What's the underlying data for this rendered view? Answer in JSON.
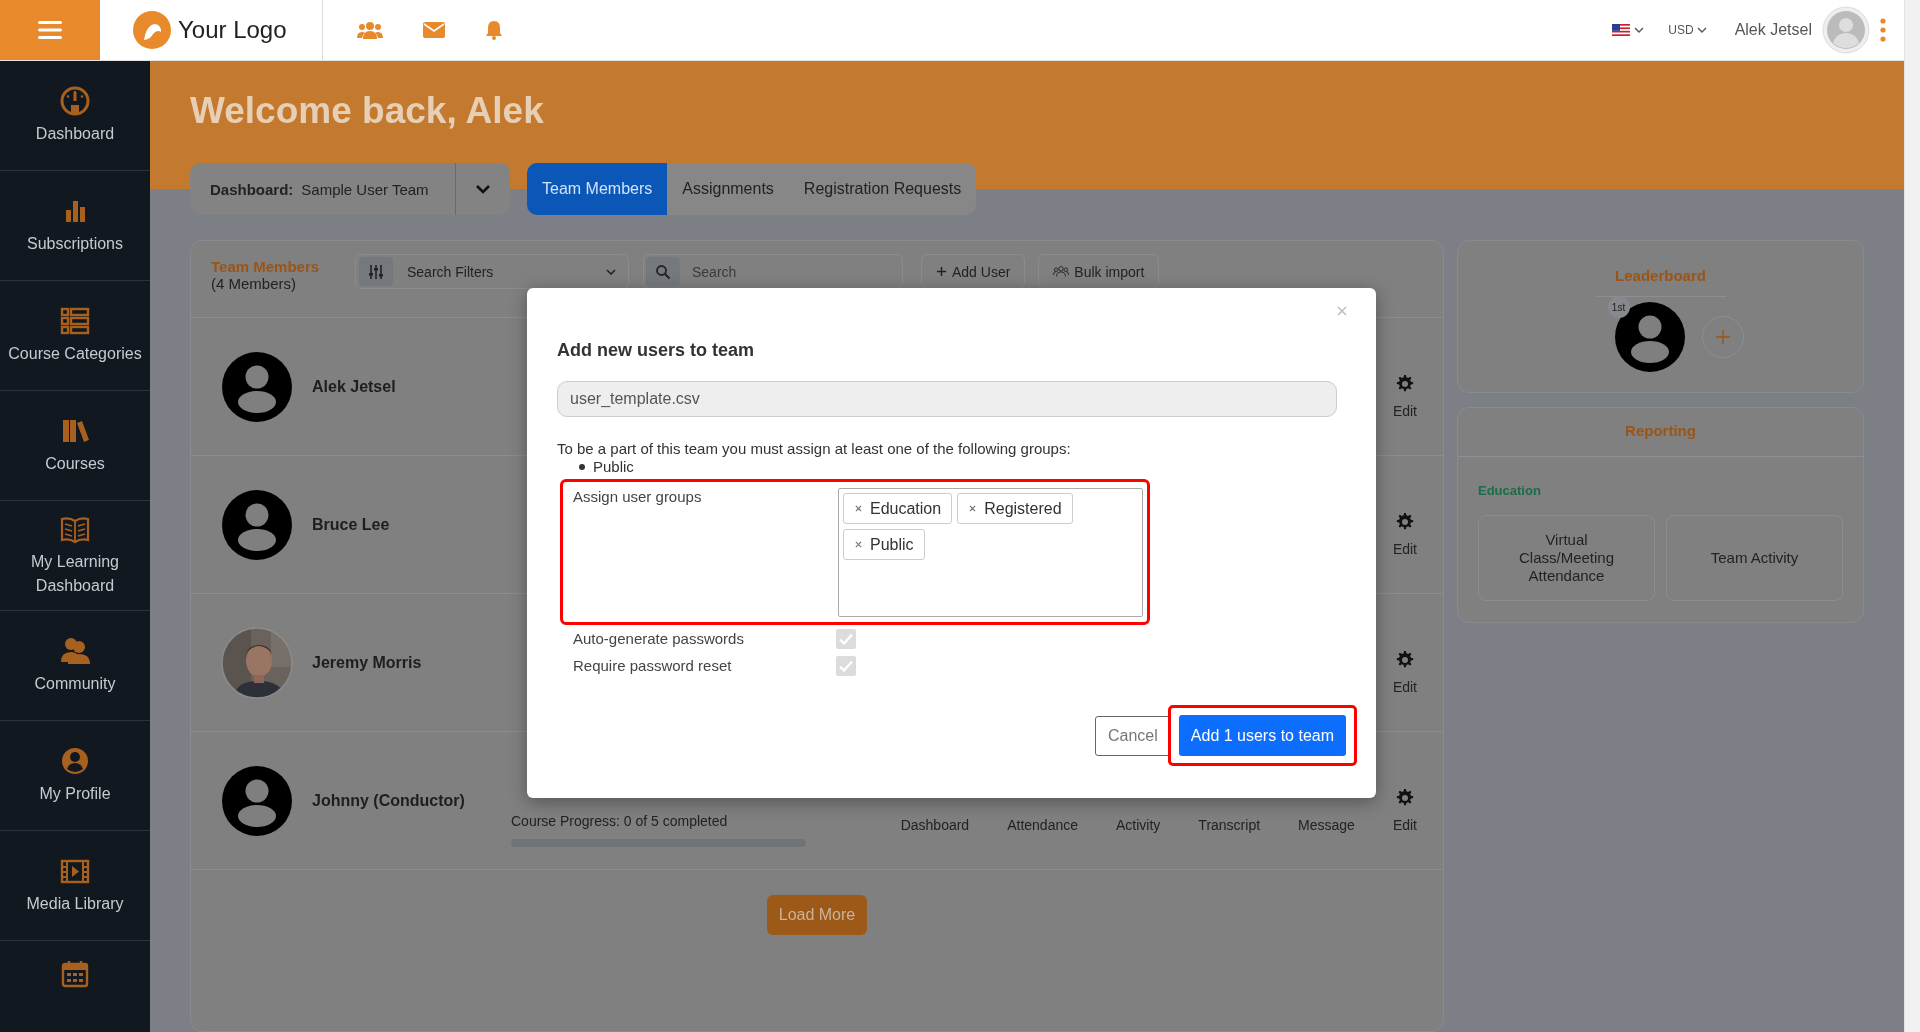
{
  "topbar": {
    "logo": "Your Logo",
    "currency": "USD",
    "user_name": "Alek Jetsel"
  },
  "sidebar": {
    "items": [
      {
        "kind": "labeled",
        "label": "Dashboard"
      },
      {
        "kind": "labeled",
        "label": "Subscriptions"
      },
      {
        "kind": "labeled",
        "label": "Course Categories"
      },
      {
        "kind": "labeled",
        "label": "Courses"
      },
      {
        "kind": "labeled",
        "label": "My Learning Dashboard"
      },
      {
        "kind": "labeled",
        "label": "Community"
      },
      {
        "kind": "labeled",
        "label": "My Profile"
      },
      {
        "kind": "labeled",
        "label": "Media Library"
      },
      {
        "kind": "icon_only"
      }
    ]
  },
  "welcome": "Welcome back, Alek",
  "dashboard_selector": {
    "label": "Dashboard:",
    "value": "Sample User Team"
  },
  "tabs": [
    {
      "label": "Team Members",
      "selected": true
    },
    {
      "label": "Assignments",
      "selected": false
    },
    {
      "label": "Registration Requests",
      "selected": false
    }
  ],
  "team_panel": {
    "title": "Team Members",
    "count": "(4 Members)",
    "filter": "Search Filters",
    "search_placeholder": "Search",
    "add_user": "Add User",
    "bulk_import": "Bulk import"
  },
  "members": [
    {
      "name": "Alek Jetsel",
      "photo": false,
      "actions": [
        "Edit"
      ]
    },
    {
      "name": "Bruce Lee",
      "photo": false,
      "actions": [
        "Edit"
      ]
    },
    {
      "name": "Jeremy Morris",
      "photo": true,
      "actions": [
        "Edit"
      ]
    },
    {
      "name": "Johnny (Conductor)",
      "photo": false,
      "progress": "Course Progress: 0 of 5 completed",
      "level": 0,
      "actions": [
        "Dashboard",
        "Attendance",
        "Activity",
        "Transcript",
        "Message",
        "Edit"
      ]
    }
  ],
  "load_more": "Load More",
  "leaderboard": {
    "title": "Leaderboard",
    "entries": [
      {
        "rank": "1st"
      }
    ]
  },
  "reporting": {
    "title": "Reporting",
    "group": "Education",
    "reports": [
      "Virtual Class/Meeting Attendance",
      "Team Activity"
    ]
  },
  "modal": {
    "title": "Add new users to team",
    "file": "user_template.csv",
    "note": "To be a part of this team you must assign at least one of the following groups:",
    "required_groups": [
      "Public"
    ],
    "groups_label": "Assign user groups",
    "groups_highlighted": true,
    "groups": [
      "Education",
      "Registered",
      "Public"
    ],
    "options": [
      {
        "label": "Auto-generate passwords",
        "checked": true,
        "disabled": true
      },
      {
        "label": "Require password reset",
        "checked": true,
        "disabled": true
      }
    ],
    "cancel": "Cancel",
    "submit": "Add 1 users to team",
    "submit_highlighted": true
  }
}
